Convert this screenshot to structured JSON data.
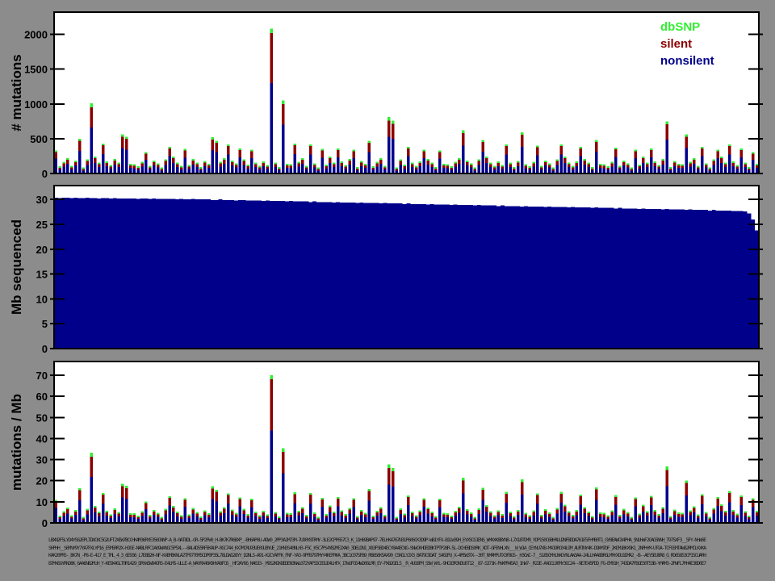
{
  "figure": {
    "background_color": "#8c8c8c",
    "panel_background": "#ffffff",
    "axis_color": "#000000",
    "x_tick_labels_legible": false
  },
  "legend": {
    "items": [
      {
        "label": "dbSNP",
        "color": "#33ee33",
        "series": "dbsnp"
      },
      {
        "label": "silent",
        "color": "#8b0000",
        "series": "silent"
      },
      {
        "label": "nonsilent",
        "color": "#00008b",
        "series": "nonsilent"
      }
    ]
  },
  "chart_data": {
    "type": "bar",
    "stacked": true,
    "orientation": "vertical",
    "n_samples": 180,
    "grid": false,
    "legend_position": "top-right-inside-first-panel",
    "panels": [
      {
        "id": "mutations",
        "ylabel": "# mutations",
        "ylim": [
          0,
          2320
        ],
        "yticks": [
          0,
          500,
          1000,
          1500,
          2000
        ],
        "series_from": "counts"
      },
      {
        "id": "mb",
        "ylabel": "Mb sequenced",
        "ylim": [
          0,
          32.8
        ],
        "yticks": [
          0,
          5,
          10,
          15,
          20,
          25,
          30
        ],
        "series_from": "mb"
      },
      {
        "id": "rate",
        "ylabel": "mutations / Mb",
        "ylim": [
          0,
          76.5
        ],
        "yticks": [
          0,
          10,
          20,
          30,
          40,
          50,
          60,
          70
        ],
        "series_from": "counts_div_mb"
      }
    ],
    "samples": {
      "totals": [
        330,
        85,
        155,
        210,
        95,
        175,
        500,
        65,
        190,
        1010,
        235,
        145,
        430,
        160,
        105,
        200,
        140,
        560,
        530,
        125,
        120,
        85,
        155,
        300,
        95,
        175,
        130,
        65,
        190,
        380,
        235,
        145,
        90,
        350,
        105,
        200,
        140,
        75,
        165,
        125,
        520,
        470,
        155,
        210,
        420,
        175,
        130,
        360,
        190,
        110,
        340,
        145,
        90,
        160,
        105,
        2080,
        140,
        75,
        1050,
        125,
        120,
        430,
        155,
        210,
        95,
        420,
        130,
        65,
        350,
        110,
        235,
        145,
        360,
        160,
        105,
        200,
        340,
        75,
        165,
        125,
        470,
        85,
        155,
        210,
        95,
        810,
        760,
        65,
        190,
        110,
        380,
        145,
        90,
        160,
        340,
        200,
        140,
        75,
        330,
        125,
        120,
        85,
        155,
        210,
        620,
        175,
        130,
        65,
        190,
        480,
        235,
        145,
        90,
        160,
        105,
        420,
        140,
        75,
        165,
        590,
        120,
        85,
        155,
        400,
        95,
        175,
        130,
        65,
        190,
        420,
        235,
        145,
        90,
        160,
        380,
        200,
        140,
        75,
        480,
        125,
        120,
        85,
        155,
        370,
        95,
        175,
        130,
        65,
        340,
        110,
        235,
        145,
        360,
        160,
        105,
        200,
        750,
        75,
        165,
        125,
        120,
        560,
        155,
        210,
        95,
        380,
        130,
        65,
        190,
        340,
        235,
        145,
        420,
        160,
        105,
        360,
        140,
        75,
        300,
        125
      ],
      "default_split": {
        "nonsilent": 0.65,
        "silent": 0.29,
        "dbsnp": 0.06
      },
      "split_overrides": {
        "9": [
          660,
          290,
          60
        ],
        "55": [
          1300,
          720,
          60
        ],
        "58": [
          700,
          300,
          50
        ],
        "85": [
          530,
          230,
          50
        ],
        "86": [
          500,
          215,
          45
        ],
        "156": [
          490,
          215,
          45
        ]
      },
      "mb": [
        30.4,
        30.3,
        30.4,
        30.4,
        30.3,
        30.4,
        30.3,
        30.3,
        30.4,
        30.3,
        30.3,
        30.2,
        30.3,
        30.3,
        30.2,
        30.3,
        30.2,
        30.2,
        30.2,
        30.2,
        30.2,
        30.1,
        30.2,
        30.2,
        30.1,
        30.2,
        30.1,
        30.1,
        30.1,
        30.1,
        30.1,
        30.0,
        30.1,
        30.0,
        30.0,
        30.1,
        30.0,
        30.0,
        30.0,
        30.0,
        29.9,
        29.9,
        30.0,
        29.9,
        29.9,
        29.9,
        29.8,
        29.9,
        29.9,
        29.8,
        29.8,
        29.8,
        29.8,
        29.7,
        29.8,
        29.7,
        29.7,
        29.7,
        29.7,
        29.6,
        29.7,
        29.6,
        29.6,
        29.6,
        29.6,
        29.5,
        29.6,
        29.5,
        29.5,
        29.5,
        29.5,
        29.4,
        29.5,
        29.4,
        29.4,
        29.4,
        29.4,
        29.3,
        29.4,
        29.3,
        29.3,
        29.3,
        29.3,
        29.2,
        29.3,
        29.2,
        29.2,
        29.2,
        29.2,
        29.1,
        29.2,
        29.1,
        29.1,
        29.1,
        29.1,
        29.0,
        29.1,
        29.0,
        29.0,
        29.0,
        29.0,
        28.9,
        29.0,
        28.9,
        28.9,
        28.9,
        28.9,
        28.8,
        28.9,
        28.8,
        28.8,
        28.8,
        28.8,
        28.7,
        28.8,
        28.7,
        28.7,
        28.7,
        28.7,
        28.6,
        28.7,
        28.6,
        28.6,
        28.6,
        28.6,
        28.5,
        28.6,
        28.5,
        28.5,
        28.5,
        28.5,
        28.4,
        28.5,
        28.4,
        28.4,
        28.4,
        28.4,
        28.3,
        28.4,
        28.3,
        28.3,
        28.3,
        28.3,
        28.2,
        28.3,
        28.2,
        28.2,
        28.2,
        28.2,
        28.1,
        28.2,
        28.1,
        28.1,
        28.1,
        28.1,
        28.0,
        28.1,
        28.0,
        28.0,
        28.0,
        28.0,
        27.9,
        28.0,
        27.9,
        27.9,
        27.9,
        27.9,
        27.8,
        27.9,
        27.8,
        27.8,
        27.8,
        27.8,
        27.7,
        27.7,
        27.7,
        27.6,
        27.2,
        26.0,
        23.8
      ]
    }
  }
}
